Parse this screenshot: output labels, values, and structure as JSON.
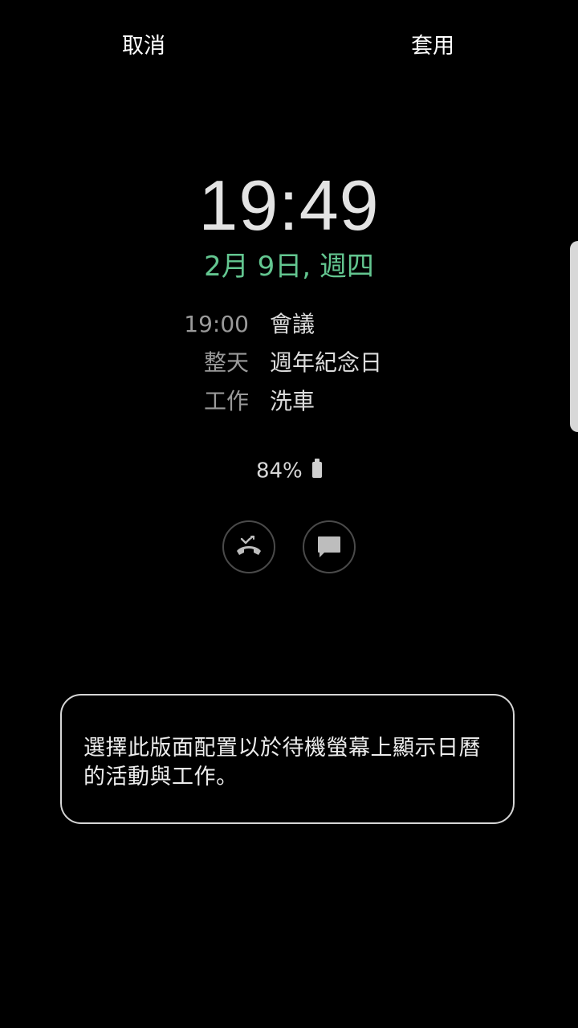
{
  "topbar": {
    "cancel_label": "取消",
    "apply_label": "套用"
  },
  "clock": {
    "time": "19:49",
    "date": "2月 9日, 週四"
  },
  "events": [
    {
      "when": "19:00",
      "what": "會議"
    },
    {
      "when": "整天",
      "what": "週年紀念日"
    },
    {
      "when": "工作",
      "what": "洗車"
    }
  ],
  "battery": {
    "percent": "84%",
    "icon": "battery-icon"
  },
  "actions": {
    "reject_icon": "reject-call-icon",
    "message_icon": "message-icon"
  },
  "info": {
    "text": "選擇此版面配置以於待機螢幕上顯示日曆的活動與工作。"
  },
  "colors": {
    "background": "#000000",
    "date_accent": "#63c690",
    "time": "#e3e3e3",
    "muted": "#9a9a9a"
  }
}
